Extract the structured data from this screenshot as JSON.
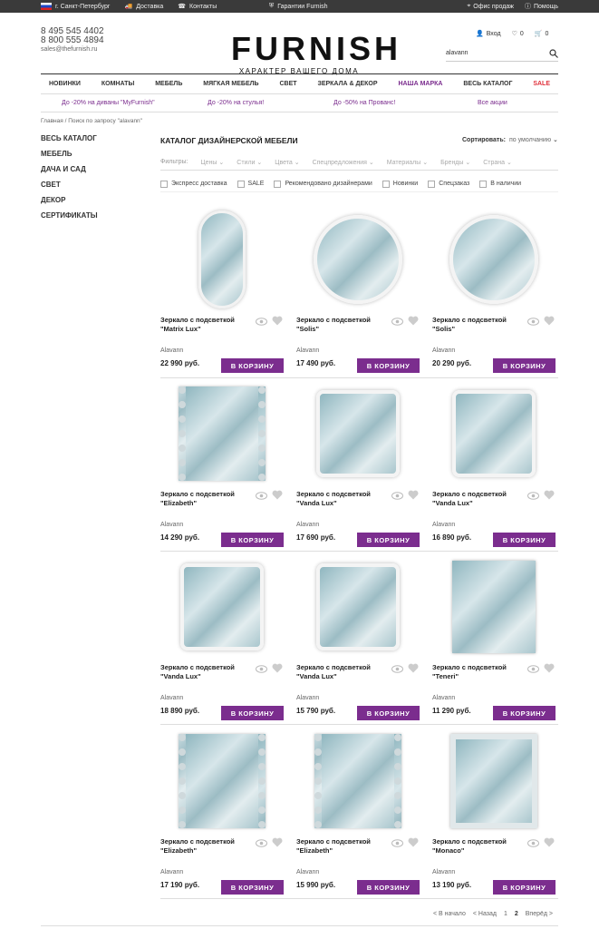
{
  "topbar": {
    "city": "г. Санкт-Петербург",
    "delivery": "Доставка",
    "contacts": "Контакты",
    "guarantee": "Гарантии Furnish",
    "office": "Офис продаж",
    "help": "Помощь"
  },
  "header": {
    "phone1": "8 495 545 4402",
    "phone2": "8 800 555 4894",
    "email": "sales@thefurnish.ru",
    "logo": "FURNISH",
    "slogan": "ХАРАКТЕР ВАШЕГО ДОМА",
    "login": "Вход",
    "fav_count": "0",
    "cart_count": "0",
    "search_value": "alavann"
  },
  "nav": [
    "НОВИНКИ",
    "КОМНАТЫ",
    "МЕБЕЛЬ",
    "МЯГКАЯ МЕБЕЛЬ",
    "СВЕТ",
    "ЗЕРКАЛА & ДЕКОР",
    "НАША МАРКА",
    "ВЕСЬ КАТАЛОГ",
    "SALE"
  ],
  "promo": [
    "До -20% на диваны \"MyFurnish\"",
    "До -20% на стулья!",
    "До -50% на Прованс!",
    "Все акции"
  ],
  "breadcrumbs": {
    "home": "Главная",
    "sep": "/",
    "current": "Поиск по запросу \"alavann\""
  },
  "sidebar": [
    "ВЕСЬ КАТАЛОГ",
    "МЕБЕЛЬ",
    "ДАЧА И САД",
    "СВЕТ",
    "ДЕКОР",
    "СЕРТИФИКАТЫ"
  ],
  "catalog": {
    "title": "КАТАЛОГ ДИЗАЙНЕРСКОЙ МЕБЕЛИ",
    "sort_label": "Сортировать:",
    "sort_value": "по умолчанию"
  },
  "filters": {
    "label": "Фильтры:",
    "items": [
      "Цены",
      "Стили",
      "Цвета",
      "Спецпредложения",
      "Материалы",
      "Бренды",
      "Страна"
    ]
  },
  "checks": [
    "Экспресс доставка",
    "SALE",
    "Рекомендовано дизайнерами",
    "Новинки",
    "Спецзаказ",
    "В наличии"
  ],
  "products": [
    {
      "name": "Зеркало с подсветкой \"Matrix Lux\"",
      "brand": "Alavann",
      "price": "22 990 руб.",
      "btn": "В КОРЗИНУ",
      "shape": "oval"
    },
    {
      "name": "Зеркало с подсветкой \"Solis\"",
      "brand": "Alavann",
      "price": "17 490 руб.",
      "btn": "В КОРЗИНУ",
      "shape": "circle"
    },
    {
      "name": "Зеркало с подсветкой \"Solis\"",
      "brand": "Alavann",
      "price": "20 290 руб.",
      "btn": "В КОРЗИНУ",
      "shape": "circle"
    },
    {
      "name": "Зеркало с подсветкой \"Elizabeth\"",
      "brand": "Alavann",
      "price": "14 290 руб.",
      "btn": "В КОРЗИНУ",
      "shape": "rect-pattern"
    },
    {
      "name": "Зеркало с подсветкой \"Vanda Lux\"",
      "brand": "Alavann",
      "price": "17 690 руб.",
      "btn": "В КОРЗИНУ",
      "shape": "rect-lit"
    },
    {
      "name": "Зеркало с подсветкой \"Vanda Lux\"",
      "brand": "Alavann",
      "price": "16 890 руб.",
      "btn": "В КОРЗИНУ",
      "shape": "rect-lit"
    },
    {
      "name": "Зеркало с подсветкой \"Vanda Lux\"",
      "brand": "Alavann",
      "price": "18 890 руб.",
      "btn": "В КОРЗИНУ",
      "shape": "rect-lit"
    },
    {
      "name": "Зеркало с подсветкой \"Vanda Lux\"",
      "brand": "Alavann",
      "price": "15 790 руб.",
      "btn": "В КОРЗИНУ",
      "shape": "rect-lit"
    },
    {
      "name": "Зеркало с подсветкой \"Teneri\"",
      "brand": "Alavann",
      "price": "11 290 руб.",
      "btn": "В КОРЗИНУ",
      "shape": "rect-plain"
    },
    {
      "name": "Зеркало с подсветкой \"Elizabeth\"",
      "brand": "Alavann",
      "price": "17 190 руб.",
      "btn": "В КОРЗИНУ",
      "shape": "rect-pattern"
    },
    {
      "name": "Зеркало с подсветкой \"Elizabeth\"",
      "brand": "Alavann",
      "price": "15 990 руб.",
      "btn": "В КОРЗИНУ",
      "shape": "rect-pattern"
    },
    {
      "name": "Зеркало с подсветкой \"Monaco\"",
      "brand": "Alavann",
      "price": "13 190 руб.",
      "btn": "В КОРЗИНУ",
      "shape": "rect-frame"
    }
  ],
  "pager": {
    "first": "< В начало",
    "prev": "< Назад",
    "p1": "1",
    "p2": "2",
    "next": "Вперёд >"
  },
  "colors": {
    "accent": "#7b2d8e",
    "sale": "#e0303a"
  }
}
